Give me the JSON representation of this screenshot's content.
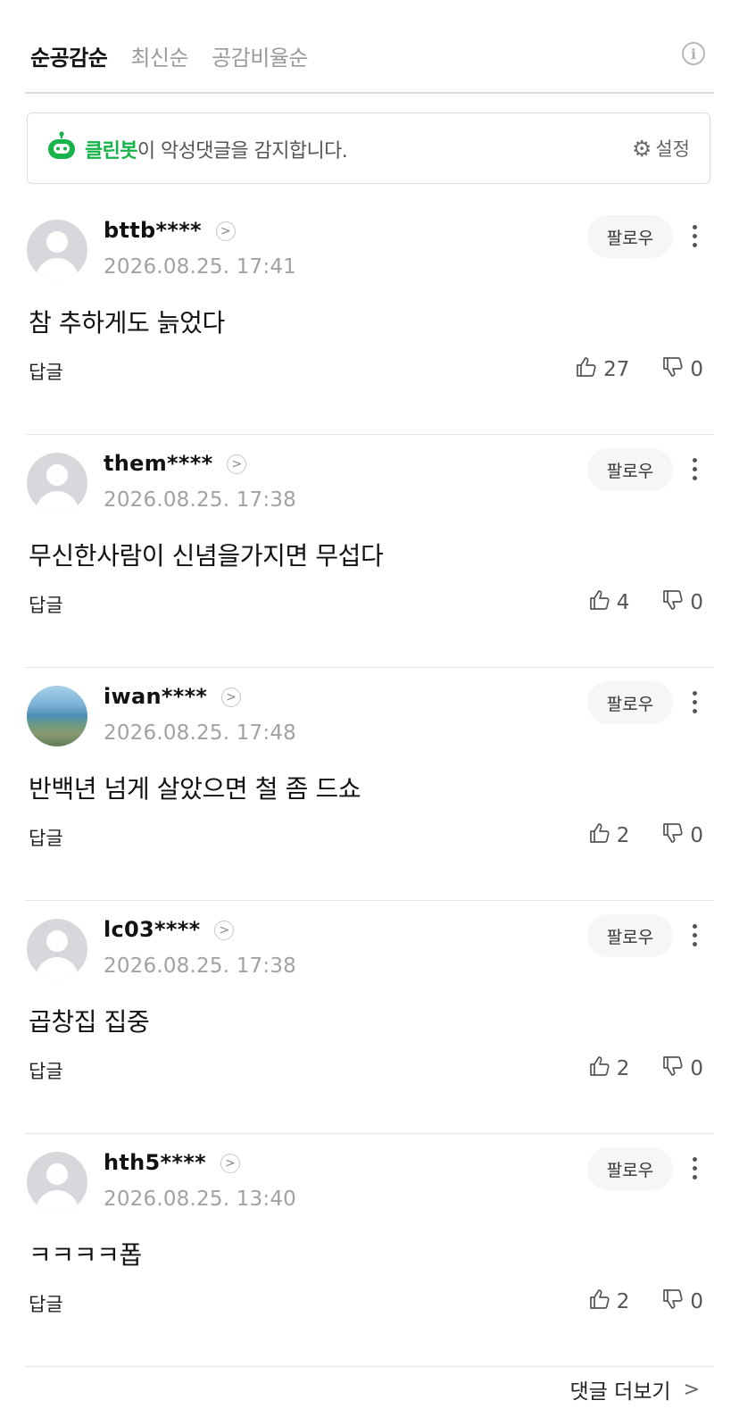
{
  "tabs": [
    "순공감순",
    "최신순",
    "공감비율순"
  ],
  "cleanbot": {
    "name": "클린봇",
    "message": "이 악성댓글을 감지합니다.",
    "settings_label": "설정"
  },
  "comments": [
    {
      "username": "bttb****",
      "timestamp": "2026.08.25. 17:41",
      "text": "참 추하게도 늙었다",
      "likes": "27",
      "dislikes": "0",
      "avatar": "default"
    },
    {
      "username": "them****",
      "timestamp": "2026.08.25. 17:38",
      "text": "무신한사람이 신념을가지면 무섭다",
      "likes": "4",
      "dislikes": "0",
      "avatar": "default"
    },
    {
      "username": "iwan****",
      "timestamp": "2026.08.25. 17:48",
      "text": "반백년 넘게 살았으면 철 좀 드쇼",
      "likes": "2",
      "dislikes": "0",
      "avatar": "photo"
    },
    {
      "username": "lc03****",
      "timestamp": "2026.08.25. 17:38",
      "text": "곱창집 집중",
      "likes": "2",
      "dislikes": "0",
      "avatar": "default"
    },
    {
      "username": "hth5****",
      "timestamp": "2026.08.25. 13:40",
      "text": "ㅋㅋㅋㅋ폽",
      "likes": "2",
      "dislikes": "0",
      "avatar": "default"
    }
  ],
  "labels": {
    "follow": "팔로우",
    "reply": "답글",
    "more_comments": "댓글 더보기"
  },
  "colors": {
    "cleanbot_green": "#16b24a",
    "timestamp_gray": "#a2a2a2"
  }
}
